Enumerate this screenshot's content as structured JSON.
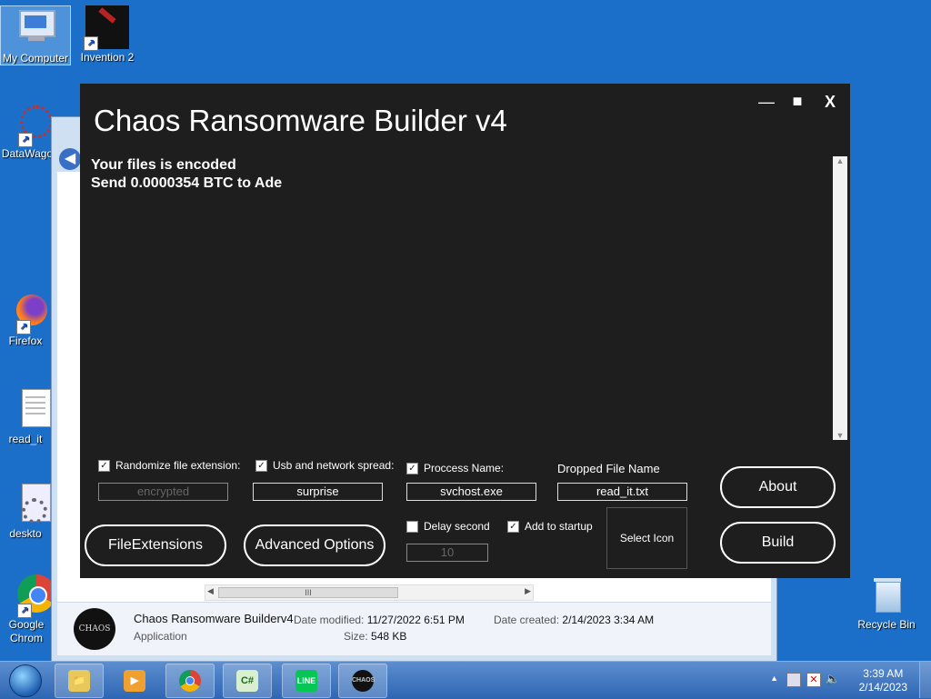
{
  "desktop": {
    "icons": [
      {
        "label": "My Computer",
        "icon": "computer-icon"
      },
      {
        "label": "Invention 2",
        "icon": "invention-icon"
      },
      {
        "label": "DataWago",
        "icon": "datawago-icon"
      },
      {
        "label": "Firefox",
        "icon": "firefox-icon"
      },
      {
        "label": "read_it",
        "icon": "text-file-icon"
      },
      {
        "label": "deskto",
        "icon": "gear-file-icon"
      },
      {
        "label": "Google Chrom",
        "icon": "chrome-icon"
      },
      {
        "label": "Recycle Bin",
        "icon": "recycle-bin-icon"
      }
    ]
  },
  "explorer": {
    "file_name": "Chaos Ransomware Builderv4",
    "file_type": "Application",
    "date_modified_label": "Date modified:",
    "date_modified": "11/27/2022 6:51 PM",
    "date_created_label": "Date created:",
    "date_created": "2/14/2023 3:34 AM",
    "size_label": "Size:",
    "size": "548 KB",
    "thumb_text": "CHAOS",
    "hscroll_grip": "III"
  },
  "builder": {
    "title": "Chaos Ransomware Builder v4",
    "minimize": "—",
    "maximize": "■",
    "close": "X",
    "note_text": "Your files is encoded\nSend 0.0000354 BTC to Ade",
    "options": {
      "randomize_ext": {
        "label": "Randomize file extension:",
        "checked": true,
        "value": "encrypted"
      },
      "usb_spread": {
        "label": "Usb and network spread:",
        "checked": true,
        "value": "surprise"
      },
      "process_name": {
        "label": "Proccess Name:",
        "checked": true,
        "value": "svchost.exe"
      },
      "dropped_file": {
        "label": "Dropped File Name",
        "value": "read_it.txt"
      },
      "delay": {
        "label": "Delay second",
        "checked": false,
        "value": "10"
      },
      "startup": {
        "label": "Add to startup",
        "checked": true
      }
    },
    "buttons": {
      "file_extensions": "FileExtensions",
      "advanced_options": "Advanced Options",
      "select_icon": "Select Icon",
      "about": "About",
      "build": "Build"
    },
    "check_mark": "✓"
  },
  "taskbar": {
    "apps": [
      {
        "icon": "folder-icon",
        "label": "📁"
      },
      {
        "icon": "media-player-icon",
        "label": "▶"
      },
      {
        "icon": "chrome-icon",
        "label": ""
      },
      {
        "icon": "csharp-icon",
        "label": "C#"
      },
      {
        "icon": "line-icon",
        "label": "LINE"
      },
      {
        "icon": "chaos-icon",
        "label": "CHAOS"
      }
    ],
    "time": "3:39 AM",
    "date": "2/14/2023",
    "tray_up_arrow": "▲"
  }
}
